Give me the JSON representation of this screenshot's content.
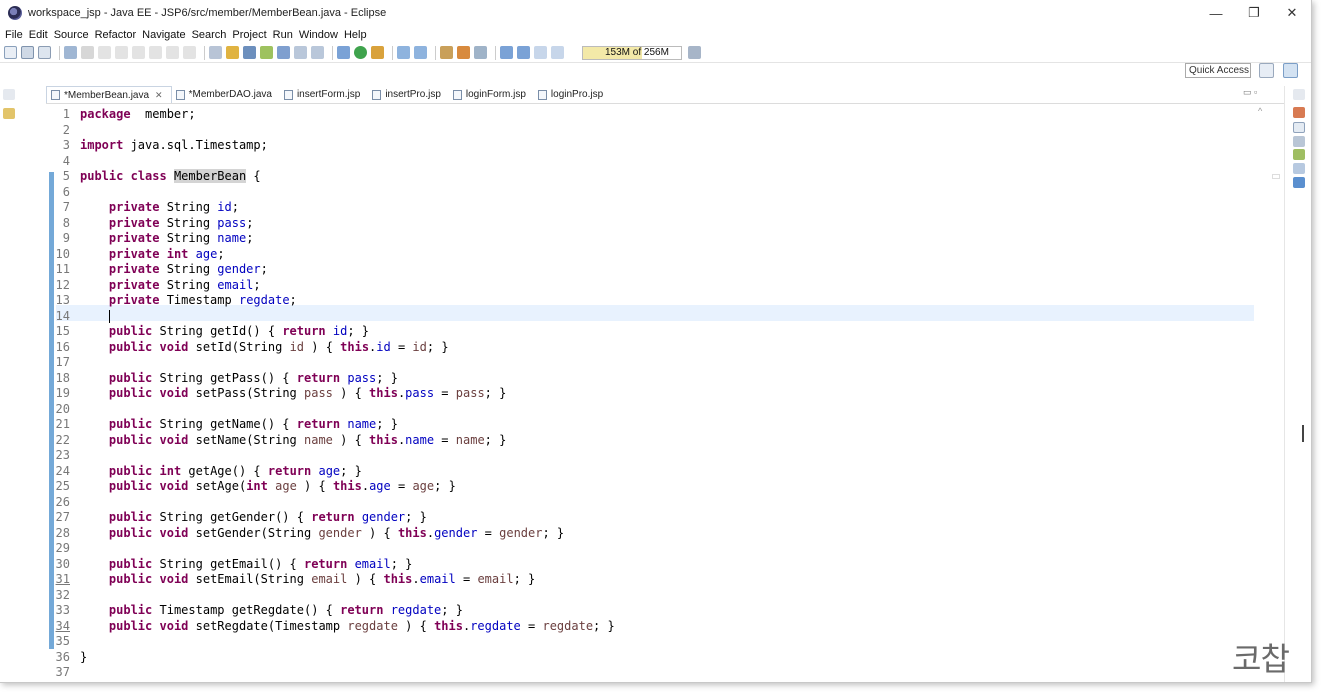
{
  "window": {
    "title": "workspace_jsp - Java EE - JSP6/src/member/MemberBean.java - Eclipse",
    "minimize": "—",
    "restore": "❐",
    "close": "✕"
  },
  "menu": [
    "File",
    "Edit",
    "Source",
    "Refactor",
    "Navigate",
    "Search",
    "Project",
    "Run",
    "Window",
    "Help"
  ],
  "toolbar": {
    "heap_status": "153M of 256M",
    "quick_access": "Quick Access"
  },
  "tabs": [
    {
      "label": "*MemberBean.java",
      "active": true,
      "close": "✕"
    },
    {
      "label": "*MemberDAO.java",
      "active": false
    },
    {
      "label": "insertForm.jsp",
      "active": false
    },
    {
      "label": "insertPro.jsp",
      "active": false
    },
    {
      "label": "loginForm.jsp",
      "active": false
    },
    {
      "label": "loginPro.jsp",
      "active": false
    }
  ],
  "editor": {
    "minimize_maximize": "▭ ▫",
    "lines": [
      {
        "n": "1",
        "t": [
          [
            "kw",
            "package"
          ],
          [
            "",
            "  member;"
          ]
        ]
      },
      {
        "n": "2",
        "t": []
      },
      {
        "n": "3",
        "t": [
          [
            "kw",
            "import"
          ],
          [
            "",
            " java.sql.Timestamp;"
          ]
        ]
      },
      {
        "n": "4",
        "t": []
      },
      {
        "n": "5",
        "t": [
          [
            "kw",
            "public"
          ],
          [
            "",
            " "
          ],
          [
            "kw",
            "class"
          ],
          [
            "",
            " "
          ],
          [
            "hl",
            "MemberBean"
          ],
          [
            "",
            " {"
          ]
        ]
      },
      {
        "n": "6",
        "t": []
      },
      {
        "n": "7",
        "t": [
          [
            "",
            "    "
          ],
          [
            "kw",
            "private"
          ],
          [
            "",
            " String "
          ],
          [
            "fld",
            "id"
          ],
          [
            "",
            ";"
          ]
        ]
      },
      {
        "n": "8",
        "t": [
          [
            "",
            "    "
          ],
          [
            "kw",
            "private"
          ],
          [
            "",
            " String "
          ],
          [
            "fld",
            "pass"
          ],
          [
            "",
            ";"
          ]
        ]
      },
      {
        "n": "9",
        "t": [
          [
            "",
            "    "
          ],
          [
            "kw",
            "private"
          ],
          [
            "",
            " String "
          ],
          [
            "fld",
            "name"
          ],
          [
            "",
            ";"
          ]
        ]
      },
      {
        "n": "10",
        "t": [
          [
            "",
            "    "
          ],
          [
            "kw",
            "private"
          ],
          [
            "",
            " "
          ],
          [
            "kw",
            "int"
          ],
          [
            "",
            " "
          ],
          [
            "fld",
            "age"
          ],
          [
            "",
            ";"
          ]
        ]
      },
      {
        "n": "11",
        "t": [
          [
            "",
            "    "
          ],
          [
            "kw",
            "private"
          ],
          [
            "",
            " String "
          ],
          [
            "fld",
            "gender"
          ],
          [
            "",
            ";"
          ]
        ]
      },
      {
        "n": "12",
        "t": [
          [
            "",
            "    "
          ],
          [
            "kw",
            "private"
          ],
          [
            "",
            " String "
          ],
          [
            "fld",
            "email"
          ],
          [
            "",
            ";"
          ]
        ]
      },
      {
        "n": "13",
        "t": [
          [
            "",
            "    "
          ],
          [
            "kw",
            "private"
          ],
          [
            "",
            " Timestamp "
          ],
          [
            "fld",
            "regdate"
          ],
          [
            "",
            ";"
          ]
        ]
      },
      {
        "n": "14",
        "t": [
          [
            "",
            "    "
          ],
          [
            "caret",
            ""
          ]
        ]
      },
      {
        "n": "15",
        "t": [
          [
            "",
            "    "
          ],
          [
            "kw",
            "public"
          ],
          [
            "",
            " String getId() { "
          ],
          [
            "kw",
            "return"
          ],
          [
            "",
            " "
          ],
          [
            "fld",
            "id"
          ],
          [
            "",
            "; }"
          ]
        ]
      },
      {
        "n": "16",
        "t": [
          [
            "",
            "    "
          ],
          [
            "kw",
            "public"
          ],
          [
            "",
            " "
          ],
          [
            "kw",
            "void"
          ],
          [
            "",
            " setId(String "
          ],
          [
            "param",
            "id"
          ],
          [
            "",
            " ) { "
          ],
          [
            "kw",
            "this"
          ],
          [
            "",
            "."
          ],
          [
            "fld",
            "id"
          ],
          [
            "",
            " = "
          ],
          [
            "param",
            "id"
          ],
          [
            "",
            "; }"
          ]
        ]
      },
      {
        "n": "17",
        "t": []
      },
      {
        "n": "18",
        "t": [
          [
            "",
            "    "
          ],
          [
            "kw",
            "public"
          ],
          [
            "",
            " String getPass() { "
          ],
          [
            "kw",
            "return"
          ],
          [
            "",
            " "
          ],
          [
            "fld",
            "pass"
          ],
          [
            "",
            "; }"
          ]
        ]
      },
      {
        "n": "19",
        "t": [
          [
            "",
            "    "
          ],
          [
            "kw",
            "public"
          ],
          [
            "",
            " "
          ],
          [
            "kw",
            "void"
          ],
          [
            "",
            " setPass(String "
          ],
          [
            "param",
            "pass"
          ],
          [
            "",
            " ) { "
          ],
          [
            "kw",
            "this"
          ],
          [
            "",
            "."
          ],
          [
            "fld",
            "pass"
          ],
          [
            "",
            " = "
          ],
          [
            "param",
            "pass"
          ],
          [
            "",
            "; }"
          ]
        ]
      },
      {
        "n": "20",
        "t": []
      },
      {
        "n": "21",
        "t": [
          [
            "",
            "    "
          ],
          [
            "kw",
            "public"
          ],
          [
            "",
            " String getName() { "
          ],
          [
            "kw",
            "return"
          ],
          [
            "",
            " "
          ],
          [
            "fld",
            "name"
          ],
          [
            "",
            "; }"
          ]
        ]
      },
      {
        "n": "22",
        "t": [
          [
            "",
            "    "
          ],
          [
            "kw",
            "public"
          ],
          [
            "",
            " "
          ],
          [
            "kw",
            "void"
          ],
          [
            "",
            " setName(String "
          ],
          [
            "param",
            "name"
          ],
          [
            "",
            " ) { "
          ],
          [
            "kw",
            "this"
          ],
          [
            "",
            "."
          ],
          [
            "fld",
            "name"
          ],
          [
            "",
            " = "
          ],
          [
            "param",
            "name"
          ],
          [
            "",
            "; }"
          ]
        ]
      },
      {
        "n": "23",
        "t": []
      },
      {
        "n": "24",
        "t": [
          [
            "",
            "    "
          ],
          [
            "kw",
            "public"
          ],
          [
            "",
            " "
          ],
          [
            "kw",
            "int"
          ],
          [
            "",
            " getAge() { "
          ],
          [
            "kw",
            "return"
          ],
          [
            "",
            " "
          ],
          [
            "fld",
            "age"
          ],
          [
            "",
            "; }"
          ]
        ]
      },
      {
        "n": "25",
        "t": [
          [
            "",
            "    "
          ],
          [
            "kw",
            "public"
          ],
          [
            "",
            " "
          ],
          [
            "kw",
            "void"
          ],
          [
            "",
            " setAge("
          ],
          [
            "kw",
            "int"
          ],
          [
            "",
            " "
          ],
          [
            "param",
            "age"
          ],
          [
            "",
            " ) { "
          ],
          [
            "kw",
            "this"
          ],
          [
            "",
            "."
          ],
          [
            "fld",
            "age"
          ],
          [
            "",
            " = "
          ],
          [
            "param",
            "age"
          ],
          [
            "",
            "; }"
          ]
        ]
      },
      {
        "n": "26",
        "t": []
      },
      {
        "n": "27",
        "t": [
          [
            "",
            "    "
          ],
          [
            "kw",
            "public"
          ],
          [
            "",
            " String getGender() { "
          ],
          [
            "kw",
            "return"
          ],
          [
            "",
            " "
          ],
          [
            "fld",
            "gender"
          ],
          [
            "",
            "; }"
          ]
        ]
      },
      {
        "n": "28",
        "t": [
          [
            "",
            "    "
          ],
          [
            "kw",
            "public"
          ],
          [
            "",
            " "
          ],
          [
            "kw",
            "void"
          ],
          [
            "",
            " setGender(String "
          ],
          [
            "param",
            "gender"
          ],
          [
            "",
            " ) { "
          ],
          [
            "kw",
            "this"
          ],
          [
            "",
            "."
          ],
          [
            "fld",
            "gender"
          ],
          [
            "",
            " = "
          ],
          [
            "param",
            "gender"
          ],
          [
            "",
            "; }"
          ]
        ]
      },
      {
        "n": "29",
        "t": []
      },
      {
        "n": "30",
        "t": [
          [
            "",
            "    "
          ],
          [
            "kw",
            "public"
          ],
          [
            "",
            " String getEmail() { "
          ],
          [
            "kw",
            "return"
          ],
          [
            "",
            " "
          ],
          [
            "fld",
            "email"
          ],
          [
            "",
            "; }"
          ]
        ]
      },
      {
        "n": "31",
        "t": [
          [
            "",
            "    "
          ],
          [
            "kw",
            "public"
          ],
          [
            "",
            " "
          ],
          [
            "kw",
            "void"
          ],
          [
            "",
            " setEmail(String "
          ],
          [
            "param",
            "email"
          ],
          [
            "",
            " ) { "
          ],
          [
            "kw",
            "this"
          ],
          [
            "",
            "."
          ],
          [
            "fld",
            "email"
          ],
          [
            "",
            " = "
          ],
          [
            "param",
            "email"
          ],
          [
            "",
            "; }"
          ]
        ],
        "underline": true
      },
      {
        "n": "32",
        "t": []
      },
      {
        "n": "33",
        "t": [
          [
            "",
            "    "
          ],
          [
            "kw",
            "public"
          ],
          [
            "",
            " Timestamp getRegdate() { "
          ],
          [
            "kw",
            "return"
          ],
          [
            "",
            " "
          ],
          [
            "fld",
            "regdate"
          ],
          [
            "",
            "; }"
          ]
        ]
      },
      {
        "n": "34",
        "t": [
          [
            "",
            "    "
          ],
          [
            "kw",
            "public"
          ],
          [
            "",
            " "
          ],
          [
            "kw",
            "void"
          ],
          [
            "",
            " setRegdate(Timestamp "
          ],
          [
            "param",
            "regdate"
          ],
          [
            "",
            " ) { "
          ],
          [
            "kw",
            "this"
          ],
          [
            "",
            "."
          ],
          [
            "fld",
            "regdate"
          ],
          [
            "",
            " = "
          ],
          [
            "param",
            "regdate"
          ],
          [
            "",
            "; }"
          ]
        ],
        "underline": true
      },
      {
        "n": "35",
        "t": []
      },
      {
        "n": "36",
        "t": [
          [
            "",
            "}"
          ]
        ]
      },
      {
        "n": "37",
        "t": []
      }
    ]
  },
  "watermark": "코찹",
  "colors": {
    "keyword": "#7f0055",
    "field": "#0000c0",
    "parameter": "#6a3e3e",
    "change_bar": "#74a9d8",
    "current_line": "#e8f2fe"
  },
  "icons": [
    "eclipse-icon",
    "new-icon",
    "save-icon",
    "debug-icon",
    "run-icon",
    "search-icon",
    "open-perspective-icon",
    "java-ee-perspective-icon"
  ]
}
